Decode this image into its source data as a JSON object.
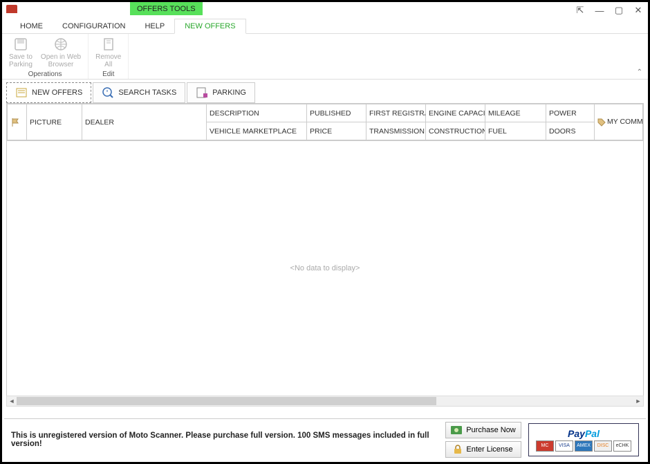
{
  "title_context": "OFFERS TOOLS",
  "menu": {
    "home": "HOME",
    "configuration": "CONFIGURATION",
    "help": "HELP",
    "new_offers": "NEW OFFERS"
  },
  "ribbon": {
    "save_to_parking": "Save to\nParking",
    "open_in_web": "Open in Web\nBrowser",
    "remove_all": "Remove\nAll",
    "group_operations": "Operations",
    "group_edit": "Edit"
  },
  "tabs": {
    "new_offers": "NEW OFFERS",
    "search_tasks": "SEARCH TASKS",
    "parking": "PARKING"
  },
  "columns": {
    "picture": "PICTURE",
    "dealer": "DEALER",
    "description": "DESCRIPTION",
    "published": "PUBLISHED",
    "first_registration": "FIRST REGISTRATION",
    "engine_capacity": "ENGINE CAPACITY",
    "mileage": "MILEAGE",
    "power": "POWER",
    "vehicle_marketplace": "VEHICLE MARKETPLACE",
    "price": "PRICE",
    "transmission": "TRANSMISSION",
    "construction_year": "CONSTRUCTION YEAR",
    "fuel": "FUEL",
    "doors": "DOORS",
    "my_comment": "MY COMMEN"
  },
  "grid_empty": "<No data to display>",
  "footer": {
    "message": "This is unregistered version of Moto Scanner. Please purchase full version. 100 SMS messages included in full version!",
    "purchase": "Purchase Now",
    "license": "Enter License"
  },
  "paypal": {
    "brand_pay": "Pay",
    "brand_pal": "Pal",
    "cards": [
      "MC",
      "VISA",
      "AMEX",
      "DISC",
      "eCHK"
    ]
  }
}
